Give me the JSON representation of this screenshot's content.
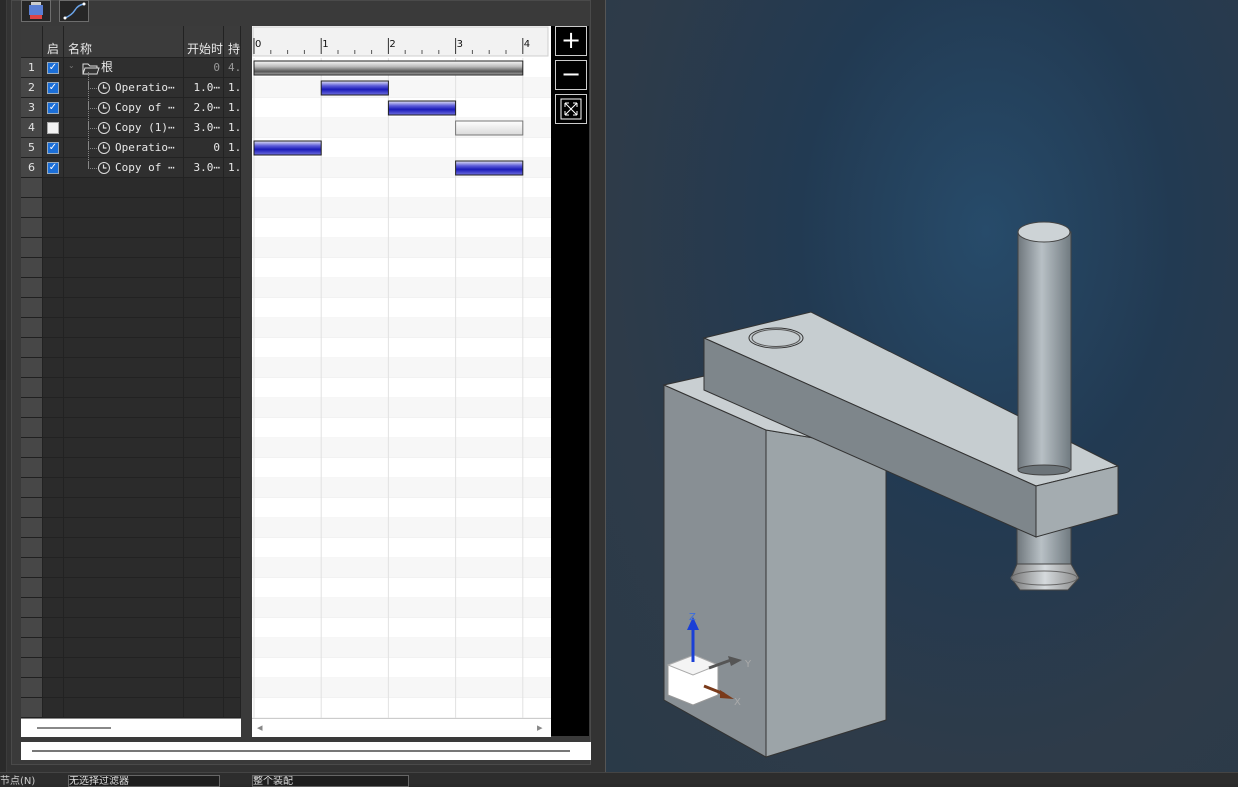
{
  "grid": {
    "columns": {
      "enable": "启",
      "name": "名称",
      "start": "开始时",
      "duration": "持"
    },
    "rows": [
      {
        "num": "1",
        "enabled": true,
        "name": "根",
        "start": "0",
        "duration": "4.",
        "icon": "folder-open-icon",
        "indent": 0
      },
      {
        "num": "2",
        "enabled": true,
        "name": "Operatio⋯",
        "start": "1.0⋯",
        "duration": "1.",
        "icon": "clock-icon",
        "indent": 1
      },
      {
        "num": "3",
        "enabled": true,
        "name": "Copy of ⋯",
        "start": "2.0⋯",
        "duration": "1.",
        "icon": "clock-icon",
        "indent": 1
      },
      {
        "num": "4",
        "enabled": false,
        "name": "Copy (1)⋯",
        "start": "3.0⋯",
        "duration": "1.",
        "icon": "clock-icon",
        "indent": 1
      },
      {
        "num": "5",
        "enabled": true,
        "name": "Operatio⋯",
        "start": "0",
        "duration": "1.",
        "icon": "clock-icon",
        "indent": 1
      },
      {
        "num": "6",
        "enabled": true,
        "name": "Copy of ⋯",
        "start": "3.0⋯",
        "duration": "1.",
        "icon": "clock-icon",
        "indent": 1
      }
    ]
  },
  "gantt": {
    "ticks": [
      "0",
      "1",
      "2",
      "3",
      "4"
    ],
    "bars": [
      {
        "start": 0,
        "end": 4,
        "style": "root"
      },
      {
        "start": 1,
        "end": 2,
        "style": "blue"
      },
      {
        "start": 2,
        "end": 3,
        "style": "blue"
      },
      {
        "start": 3,
        "end": 4,
        "style": "white"
      },
      {
        "start": 0,
        "end": 1,
        "style": "blue"
      },
      {
        "start": 3,
        "end": 4,
        "style": "blue"
      }
    ]
  },
  "zoom": {
    "in": "+",
    "out": "−",
    "fit": "⤢"
  },
  "axes": {
    "z": "Z",
    "y": "Y",
    "x": "X"
  },
  "statusbar": {
    "left_label": "节点(N)",
    "filter": "无选择过滤器",
    "mode": "整个装配"
  }
}
